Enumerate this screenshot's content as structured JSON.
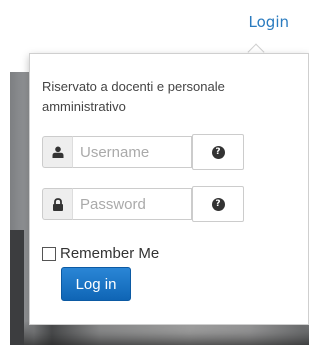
{
  "header": {
    "login_link": "Login"
  },
  "panel": {
    "note": "Riservato a docenti e personale amministrativo",
    "username": {
      "value": "",
      "placeholder": "Username"
    },
    "password": {
      "value": "",
      "placeholder": "Password"
    },
    "help_glyph": "?",
    "remember_label": "Remember Me",
    "remember_checked": false,
    "submit_label": "Log in"
  },
  "colors": {
    "link": "#2a7bbf",
    "primary_button": "#1a74c6"
  },
  "icons": {
    "username": "user-icon",
    "password": "lock-icon",
    "help": "question-circle-icon"
  }
}
